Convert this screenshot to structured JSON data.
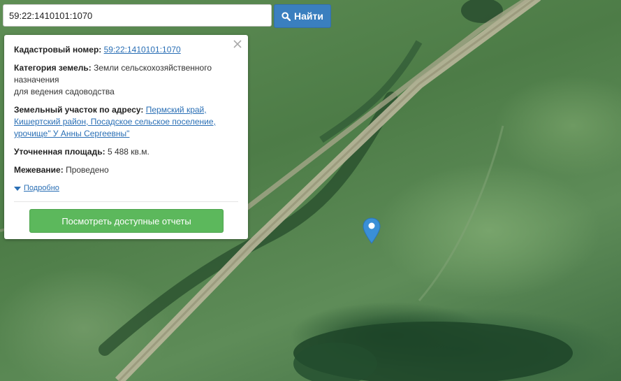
{
  "search": {
    "value": "59:22:1410101:1070",
    "button_label": "Найти",
    "button_icon": "search-icon",
    "accent": "#3a7fbf"
  },
  "info": {
    "cadastral_label": "Кадастровый номер:",
    "cadastral_value": "59:22:1410101:1070",
    "category_label": "Категория земель:",
    "category_line1": "Земли сельскохозяйственного",
    "category_line2": "назначения",
    "category_line3": "для ведения садоводства",
    "address_label": "Земельный участок по адресу:",
    "address_line1": "Пермский край,",
    "address_line2": "Кишертский район, Посадское сельское поселение,",
    "address_line3": "урочище\" У Анны Сергеевны\"",
    "area_label": "Уточненная площадь:",
    "area_value": "5 488 кв.м.",
    "survey_label": "Межевание:",
    "survey_value": "Проведено",
    "details_label": "Подробно",
    "reports_button": "Посмотреть доступные отчеты",
    "reports_color": "#5cb85c",
    "close_icon": "close-icon"
  },
  "map": {
    "marker_icon": "map-pin-icon",
    "marker_color": "#3a8fd6"
  }
}
